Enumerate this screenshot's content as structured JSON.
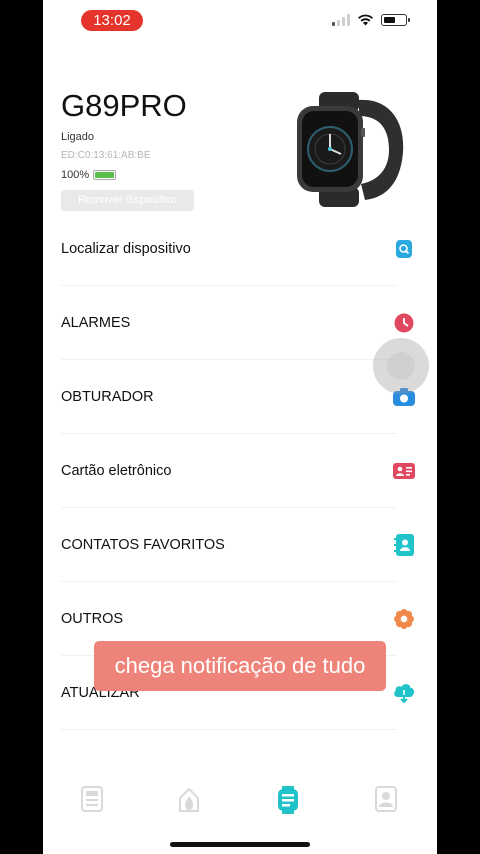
{
  "status_bar": {
    "time": "13:02"
  },
  "device": {
    "name": "G89PRO",
    "status": "Ligado",
    "mac": "ED:C0:13:61:AB:BE",
    "battery": "100%",
    "battery_level": 1.0,
    "remove_label": "Remover dispositivo"
  },
  "menu": {
    "items": [
      {
        "label": "Localizar dispositivo",
        "icon": "locate-icon",
        "color": "#2aa8e0"
      },
      {
        "label": "ALARMES",
        "icon": "alarm-icon",
        "color": "#e0485f"
      },
      {
        "label": "OBTURADOR",
        "icon": "camera-icon",
        "color": "#2a8ee0"
      },
      {
        "label": "Cartão eletrônico",
        "icon": "card-icon",
        "color": "#e0485f"
      },
      {
        "label": "CONTATOS FAVORITOS",
        "icon": "contacts-icon",
        "color": "#20c3c9"
      },
      {
        "label": "OUTROS",
        "icon": "others-icon",
        "color": "#f08a4b"
      },
      {
        "label": "ATUALIZAR",
        "icon": "update-icon",
        "color": "#20c3c9"
      }
    ]
  },
  "caption": "chega notificação de tudo",
  "tabbar": {
    "tabs": [
      {
        "icon": "data-tab-icon",
        "active": false
      },
      {
        "icon": "sport-tab-icon",
        "active": false
      },
      {
        "icon": "device-tab-icon",
        "active": true
      },
      {
        "icon": "profile-tab-icon",
        "active": false
      }
    ],
    "active_color": "#20c3c9",
    "inactive_color": "#d9d9d9"
  }
}
